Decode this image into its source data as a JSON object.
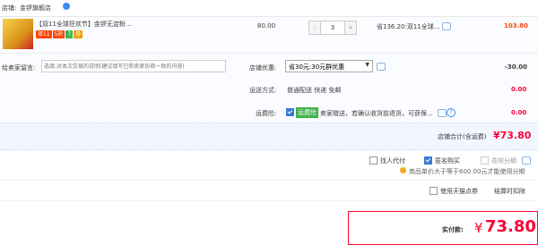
{
  "store": {
    "label": "店铺:",
    "name": "金锣旗舰店"
  },
  "product": {
    "title": "【双11全球狂欢节】金锣无淀粉...",
    "badges": [
      {
        "text": "双11",
        "color": "#ff4400"
      },
      {
        "text": "5折",
        "color": "#ff4400"
      },
      {
        "text": "7",
        "color": "#3fb24d"
      },
      {
        "text": "券",
        "color": "#f0a100"
      }
    ],
    "price": "80.00",
    "quantity": "3",
    "minus": "-",
    "plus": "+",
    "discount": "省136.20:双11全球...",
    "subtotal": "103.80"
  },
  "message": {
    "label": "给卖家留言:",
    "placeholder": "选填:对本次交易的说明(建议填写已和卖家协商一致的内容)"
  },
  "promo": {
    "label": "店铺优惠:",
    "selected": "省30元:30元群优惠",
    "amount": "-30.00"
  },
  "shipping": {
    "label": "运送方式:",
    "value": "普通配送 快递 免邮",
    "amount": "0.00"
  },
  "insurance": {
    "label": "运费险:",
    "tag": "运费险",
    "text": "卖家赠送，若确认收货前退货，可获保...",
    "amount": "0.00"
  },
  "store_total": {
    "label": "店铺合计(含运费)",
    "value": "¥73.80"
  },
  "options": {
    "proxy": "找人代付",
    "anonymous": "匿名购买",
    "huabei": "花呗分期",
    "huabei_note": "商品单价大于等于600.00元才能使用分期",
    "tmall_points": "使用天猫点券",
    "points_note": "结算时扣除"
  },
  "final": {
    "label": "实付款:",
    "currency": "¥",
    "value": "73.80"
  },
  "colors": {
    "accent_red": "#ff0036",
    "orange": "#f40",
    "border": "#e5e5e5"
  }
}
